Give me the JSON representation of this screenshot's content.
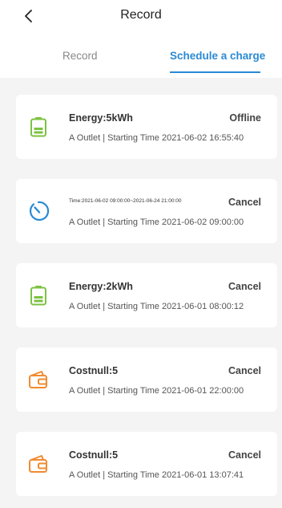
{
  "header": {
    "title": "Record"
  },
  "tabs": [
    {
      "label": "Record"
    },
    {
      "label": "Schedule a charge"
    }
  ],
  "cards": [
    {
      "icon": "battery-icon",
      "icon_color": "#7cc242",
      "headline": "Energy:5kWh",
      "status": "Offline",
      "detail": "A Outlet | Starting Time 2021-06-02 16:55:40"
    },
    {
      "icon": "timer-icon",
      "icon_color": "#2a8ad4",
      "headline": "Time:2021-06-02 09:00:00~2021-06-24 21:00:00",
      "status": "Cancel",
      "detail": "A Outlet | Starting Time 2021-06-02 09:00:00"
    },
    {
      "icon": "battery-icon",
      "icon_color": "#7cc242",
      "headline": "Energy:2kWh",
      "status": "Cancel",
      "detail": "A Outlet | Starting Time 2021-06-01 08:00:12"
    },
    {
      "icon": "wallet-icon",
      "icon_color": "#f08b30",
      "headline": "Costnull:5",
      "status": "Cancel",
      "detail": "A Outlet | Starting Time 2021-06-01 22:00:00"
    },
    {
      "icon": "wallet-icon",
      "icon_color": "#f08b30",
      "headline": "Costnull:5",
      "status": "Cancel",
      "detail": "A Outlet | Starting Time 2021-06-01 13:07:41"
    }
  ]
}
